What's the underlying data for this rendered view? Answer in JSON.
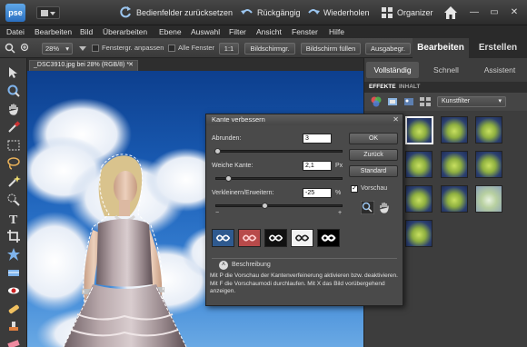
{
  "app": {
    "logo_text": "pse",
    "reset_panels_label": "Bedienfelder zurücksetzen",
    "undo_label": "Rückgängig",
    "redo_label": "Wiederholen",
    "organizer_label": "Organizer"
  },
  "menu": {
    "items": [
      "Datei",
      "Bearbeiten",
      "Bild",
      "Überarbeiten",
      "Ebene",
      "Auswahl",
      "Filter",
      "Ansicht",
      "Fenster",
      "Hilfe"
    ]
  },
  "options": {
    "zoom_value": "28%",
    "fit_windows_label": "Fenstergr. anpassen",
    "all_windows_label": "Alle Fenster",
    "actual_pixels_label": "1:1",
    "screen_size_label": "Bildschirmgr.",
    "fill_screen_label": "Bildschirm füllen",
    "print_size_label": "Ausgabegr."
  },
  "right_tabs": {
    "edit_label": "Bearbeiten",
    "create_label": "Erstellen"
  },
  "document": {
    "tab_label": "_DSC3910.jpg bei 28% (RGB/8) *"
  },
  "panel": {
    "modes": [
      "Vollständig",
      "Schnell",
      "Assistent"
    ],
    "fx_tabs": [
      "EFFEKTE",
      "INHALT"
    ],
    "filter_select": "Kunstfilter"
  },
  "dialog": {
    "title": "Kante verbessern",
    "smooth_label": "Abrunden:",
    "smooth_value": "3",
    "feather_label": "Weiche Kante:",
    "feather_value": "2,1",
    "feather_unit": "Px",
    "contract_label": "Verkleinern/Erweitern:",
    "contract_value": "-25",
    "contract_unit": "%",
    "minus": "−",
    "plus": "+",
    "ok_label": "OK",
    "cancel_label": "Zurück",
    "default_label": "Standard",
    "preview_label": "Vorschau",
    "description_header": "Beschreibung",
    "description_text": "Mit P die Vorschau der Kantenverfeinerung aktivieren bzw. deaktivieren. Mit F die Vorschaumodi durchlaufen. Mit X das Bild vorübergehend anzeigen."
  }
}
